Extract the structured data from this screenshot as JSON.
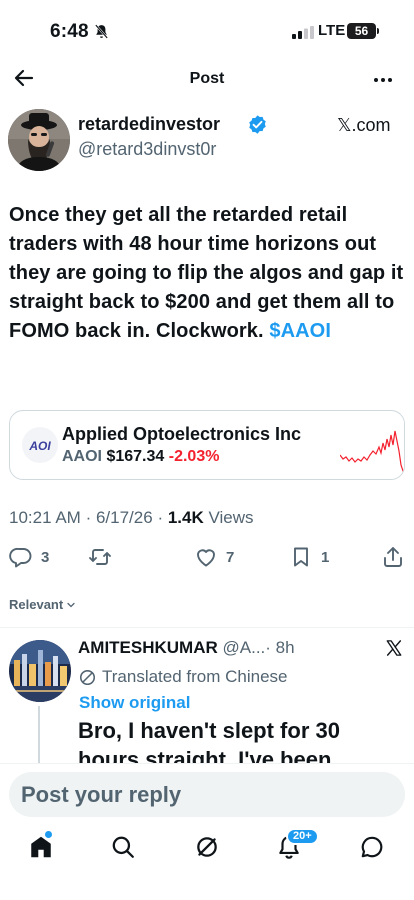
{
  "status_bar": {
    "time": "6:48",
    "network": "LTE",
    "battery": "56"
  },
  "nav": {
    "title": "Post"
  },
  "author": {
    "name": "retardedinvestor",
    "handle": "@retard3dinvst0r",
    "source": "𝕏.com"
  },
  "tweet": {
    "text": "Once they get all the retarded retail traders with 48 hour time horizons out they are going to flip the algos and gap it straight back to $200 and get them all to FOMO back in. Clockwork.",
    "cashtag": "$AAOI"
  },
  "ticker_card": {
    "logo_text": "AOI",
    "company": "Applied Optoelectronics Inc",
    "symbol": "AAOI",
    "price": "$167.34",
    "change": "-2.03%",
    "colors": {
      "change": "#f4212e",
      "chart": "#f4212e"
    }
  },
  "meta": {
    "time": "10:21 AM",
    "date": "6/17/26",
    "views_count": "1.4K",
    "views_label": "Views",
    "separator": "·"
  },
  "actions": {
    "replies": "3",
    "retweets": "",
    "likes": "7",
    "bookmarks": "1"
  },
  "sort_label": "Relevant",
  "reply": {
    "name": "AMITESHKUMAR",
    "handle": "@A...",
    "time": "· 8h",
    "translated_label": "Translated from Chinese",
    "show_original": "Show original",
    "text": "Bro, I haven't slept for 30 hours straight. I've been"
  },
  "composer": {
    "placeholder": "Post your reply"
  },
  "tab_bar": {
    "notifications_badge": "20+"
  },
  "colors": {
    "accent": "#1d9bf0",
    "text": "#0f1419",
    "secondary": "#536471",
    "negative": "#f4212e"
  },
  "icons": [
    "back-arrow-icon",
    "more-icon",
    "verified-badge-icon",
    "reply-icon",
    "retweet-icon",
    "like-icon",
    "bookmark-icon",
    "share-icon",
    "chevron-down-icon",
    "translate-icon",
    "x-logo-icon",
    "home-icon",
    "search-icon",
    "grok-icon",
    "bell-icon",
    "messages-icon"
  ]
}
